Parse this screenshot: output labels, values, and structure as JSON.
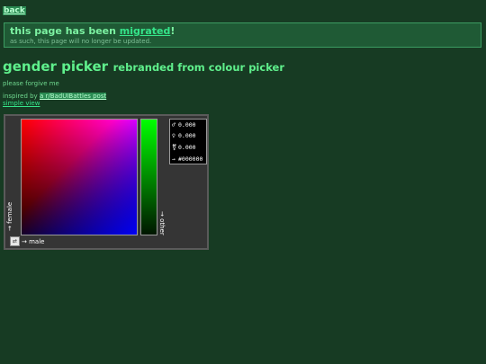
{
  "back_label": "back",
  "notice": {
    "title_prefix": "this page has been ",
    "title_link": "migrated",
    "title_suffix": "!",
    "subtitle": "as such, this page will no longer be updated."
  },
  "heading": {
    "main": "gender picker",
    "sub": "rebranded from colour picker"
  },
  "forgive_text": "please forgive me",
  "inspired": {
    "prefix": "inspired by ",
    "link": "a r/BadUIBattles post"
  },
  "simple_view_label": "simple view",
  "picker": {
    "axis_female": "→ female",
    "axis_male": "→ male",
    "axis_other": "→ other",
    "swap_icon": "⇄",
    "readout": [
      {
        "symbol": "♂",
        "value": "0.000"
      },
      {
        "symbol": "♀",
        "value": "0.000"
      },
      {
        "symbol": "⚧",
        "value": "0.000"
      },
      {
        "symbol": "→",
        "value": "#000000"
      }
    ],
    "colors": {
      "field_top_left": "#ff0000",
      "field_top_right": "#ff00ff",
      "field_bottom_right": "#0000ff",
      "slider_top": "#00ff00",
      "slider_bottom": "#001600"
    }
  }
}
